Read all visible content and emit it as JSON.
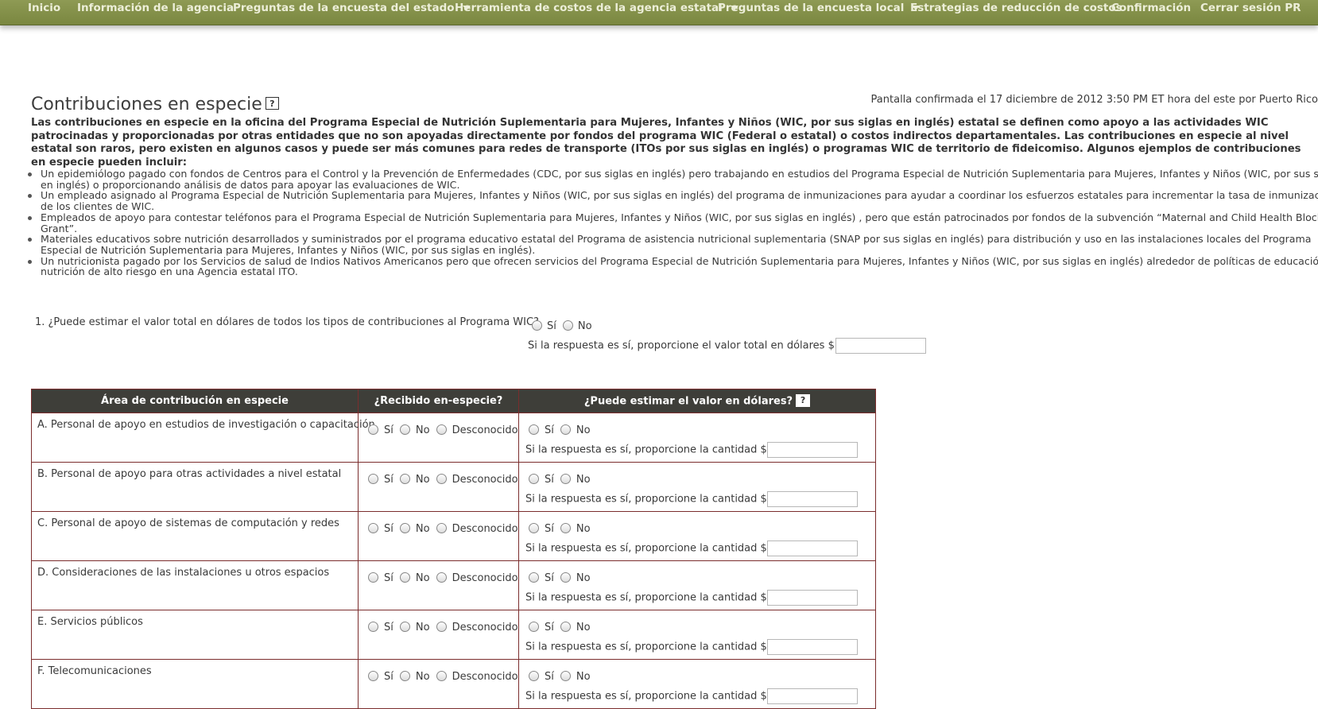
{
  "nav": {
    "items": [
      {
        "label": "Inicio",
        "dropdown": false
      },
      {
        "label": "Información de la agencia",
        "dropdown": false
      },
      {
        "label": "Preguntas de la encuesta del estado",
        "dropdown": true
      },
      {
        "label": "Herramienta de costos de la agencia estatal",
        "dropdown": true
      },
      {
        "label": "Preguntas de la encuesta local",
        "dropdown": true
      },
      {
        "label": "Estrategias de reducción de costos",
        "dropdown": false
      },
      {
        "label": "Confirmación",
        "dropdown": false
      },
      {
        "label": "Cerrar sesión PR",
        "dropdown": false
      }
    ]
  },
  "page": {
    "title": "Contribuciones en especie",
    "help": "?",
    "confirmation": "Pantalla confirmada el 17 diciembre de 2012 3:50 PM ET hora del este por Puerto Rico",
    "intro": "Las contribuciones en especie en la oficina del Programa Especial de Nutrición Suplementaria para Mujeres, Infantes y Niños (WIC, por sus siglas en inglés) estatal se definen como apoyo a las actividades WIC patrocinadas y proporcionadas por otras entidades que no son apoyadas directamente por fondos del programa WIC (Federal o estatal) o costos indirectos departamentales. Las contribuciones en especie al nivel estatal son raros, pero existen en algunos casos y puede ser más comunes para redes de transporte (ITOs por sus siglas en inglés) o programas WIC de territorio de fideicomiso. Algunos ejemplos de contribuciones en especie pueden incluir:",
    "bullets": [
      "Un epidemiólogo pagado con fondos de Centros para el Control y la Prevención de Enfermedades (CDC, por sus siglas en inglés) pero trabajando en estudios del Programa Especial de Nutrición Suplementaria para Mujeres, Infantes y Niños (WIC, por sus siglas en inglés) o proporcionando análisis de datos para apoyar las evaluaciones de WIC.",
      "Un empleado asignado al Programa Especial de Nutrición Suplementaria para Mujeres, Infantes y Niños (WIC, por sus siglas en inglés) del programa de inmunizaciones para ayudar a coordinar los esfuerzos estatales para incrementar la tasa de inmunización de los clientes de WIC.",
      "Empleados de apoyo para contestar teléfonos para el Programa Especial de Nutrición Suplementaria para Mujeres, Infantes y Niños (WIC, por sus siglas en inglés) , pero que están patrocinados por fondos de la subvención “Maternal and Child Health Block Grant”.",
      "Materiales educativos sobre nutrición desarrollados y suministrados por el programa educativo estatal del Programa de asistencia nutricional suplementaria (SNAP por sus siglas en inglés) para distribución y uso en las instalaciones locales del Programa Especial de Nutrición Suplementaria para Mujeres, Infantes y Niños (WIC, por sus siglas en inglés).",
      "Un nutricionista pagado por los Servicios de salud de Indios Nativos Americanos pero que ofrecen servicios del Programa Especial de Nutrición Suplementaria para Mujeres, Infantes y Niños (WIC, por sus siglas en inglés) alrededor de políticas de educación de nutrición de alto riesgo en una Agencia estatal ITO."
    ]
  },
  "q1": {
    "text": "1. ¿Puede estimar el valor total en dólares de todos los tipos de contribuciones al Programa WIC?",
    "yes": "Sí",
    "no": "No",
    "followup": "Si la respuesta es sí, proporcione el valor total en dólares $",
    "value": ""
  },
  "table": {
    "headers": {
      "area": "Área de contribución en especie",
      "received": "¿Recibido en-especie?",
      "estimate": "¿Puede estimar el valor en dólares?",
      "help": "?"
    },
    "labels": {
      "yes": "Sí",
      "no": "No",
      "unknown": "Desconocido",
      "followup": "Si la respuesta es sí, proporcione la cantidad $"
    },
    "rows": [
      {
        "area": "A. Personal de apoyo en estudios de investigación o capacitación",
        "amount": ""
      },
      {
        "area": "B. Personal de apoyo para otras actividades a nivel estatal",
        "amount": ""
      },
      {
        "area": "C. Personal de apoyo de sistemas de computación y redes",
        "amount": ""
      },
      {
        "area": "D. Consideraciones de las instalaciones u otros espacios",
        "amount": ""
      },
      {
        "area": "E. Servicios públicos",
        "amount": ""
      },
      {
        "area": "F. Telecomunicaciones",
        "amount": ""
      }
    ]
  }
}
